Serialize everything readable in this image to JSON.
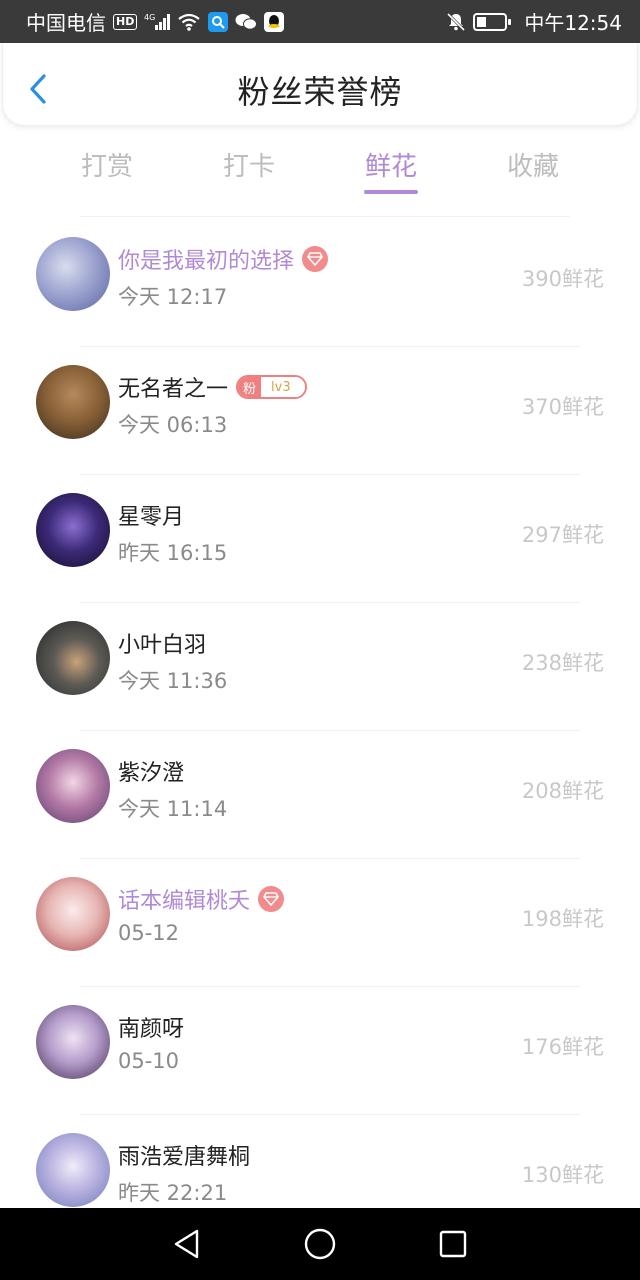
{
  "status_bar": {
    "carrier": "中国电信",
    "hd": "HD",
    "network": "4G",
    "time": "中午12:54"
  },
  "header": {
    "title": "粉丝荣誉榜"
  },
  "tabs": [
    {
      "label": "打赏",
      "active": false
    },
    {
      "label": "打卡",
      "active": false
    },
    {
      "label": "鲜花",
      "active": true
    },
    {
      "label": "收藏",
      "active": false
    }
  ],
  "list": [
    {
      "name": "你是我最初的选择",
      "time": "今天 12:17",
      "amount": "390鲜花",
      "vip": true
    },
    {
      "name": "无名者之一",
      "time": "今天 06:13",
      "amount": "370鲜花",
      "fan_badge": {
        "label": "粉",
        "level": "lv3"
      }
    },
    {
      "name": "星零月",
      "time": "昨天 16:15",
      "amount": "297鲜花"
    },
    {
      "name": "小叶白羽",
      "time": "今天 11:36",
      "amount": "238鲜花"
    },
    {
      "name": "紫汐澄",
      "time": "今天 11:14",
      "amount": "208鲜花"
    },
    {
      "name": "话本编辑桃夭",
      "time": "05-12",
      "amount": "198鲜花",
      "vip": true
    },
    {
      "name": "南颜呀",
      "time": "05-10",
      "amount": "176鲜花"
    },
    {
      "name": "雨浩爱唐舞桐",
      "time": "昨天 22:21",
      "amount": "130鲜花"
    }
  ],
  "colors": {
    "accent": "#b08ad8",
    "vip_badge": "#f28b8b",
    "secondary_text": "#8a8a8a",
    "amount_text": "#c8c8c8"
  },
  "icons": {
    "back": "chevron-left-icon",
    "vip": "gem-icon",
    "nav_back": "triangle-back-icon",
    "nav_home": "circle-home-icon",
    "nav_recent": "square-recent-icon"
  }
}
